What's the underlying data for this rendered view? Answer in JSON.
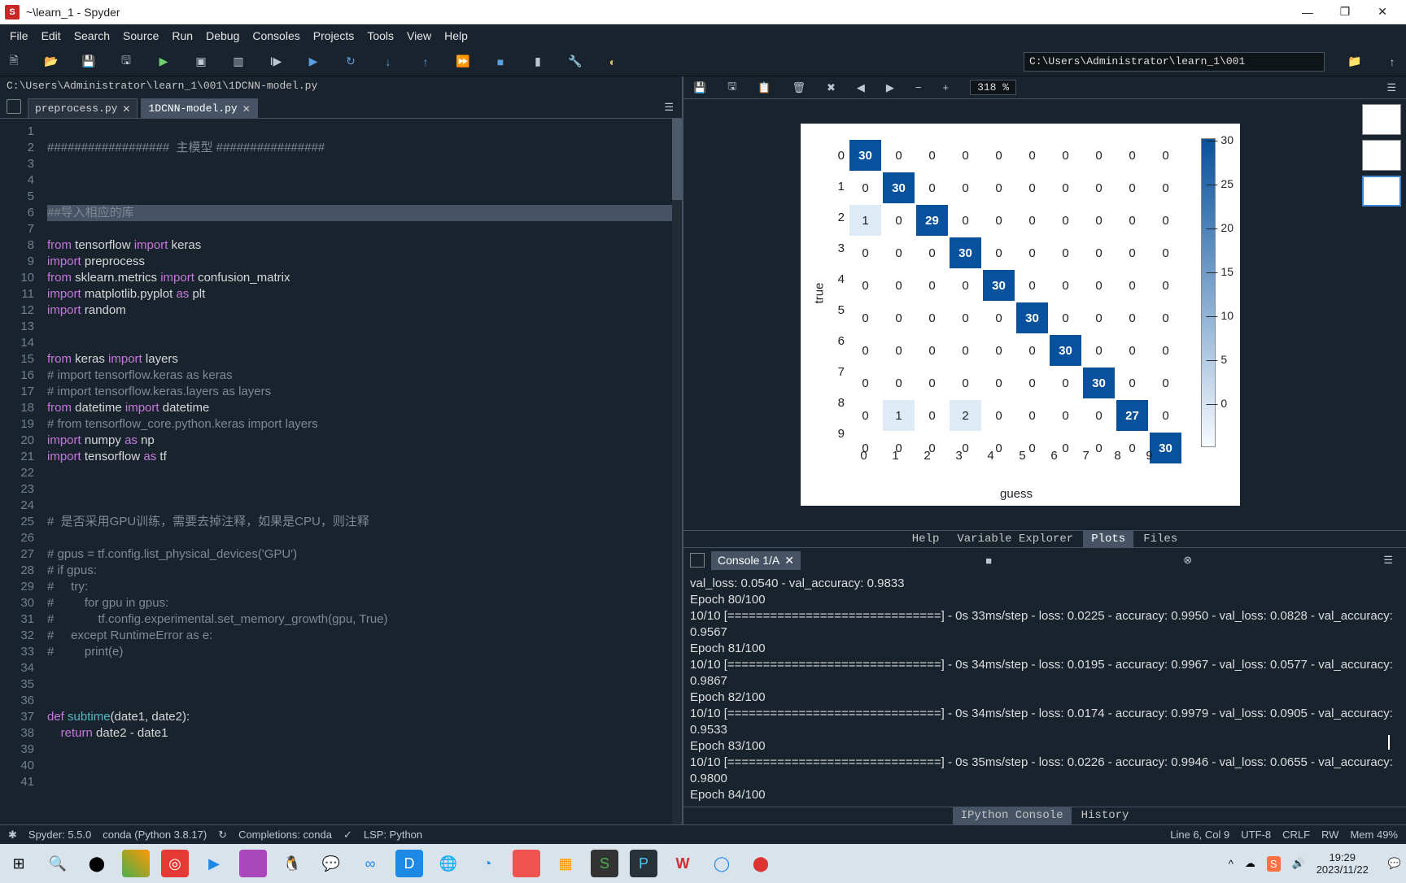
{
  "title": "~\\learn_1 - Spyder",
  "win_buttons": {
    "min": "—",
    "max": "❐",
    "close": "✕"
  },
  "menu": [
    "File",
    "Edit",
    "Search",
    "Source",
    "Run",
    "Debug",
    "Consoles",
    "Projects",
    "Tools",
    "View",
    "Help"
  ],
  "toolbar_path": "C:\\Users\\Administrator\\learn_1\\001",
  "editor_path": "C:\\Users\\Administrator\\learn_1\\001\\1DCNN-model.py",
  "tabs": [
    {
      "label": "preprocess.py",
      "active": false
    },
    {
      "label": "1DCNN-model.py",
      "active": true
    }
  ],
  "code_lines": [
    {
      "n": 1,
      "html": ""
    },
    {
      "n": 2,
      "html": "<span class='cmt'>##################  主模型 ################</span>"
    },
    {
      "n": 3,
      "html": ""
    },
    {
      "n": 4,
      "html": ""
    },
    {
      "n": 5,
      "html": ""
    },
    {
      "n": 6,
      "html": "<span class='cmt'>##导入相应的库</span>",
      "hl": true
    },
    {
      "n": 7,
      "html": ""
    },
    {
      "n": 8,
      "html": "<span class='kw'>from</span> <span class='mod'>tensorflow</span> <span class='kw'>import</span> <span class='mod'>keras</span>"
    },
    {
      "n": 9,
      "html": "<span class='kw'>import</span> <span class='mod'>preprocess</span>"
    },
    {
      "n": 10,
      "html": "<span class='kw'>from</span> <span class='mod'>sklearn.metrics</span> <span class='kw'>import</span> <span class='mod'>confusion_matrix</span>"
    },
    {
      "n": 11,
      "html": "<span class='kw'>import</span> <span class='mod'>matplotlib.pyplot</span> <span class='kw'>as</span> <span class='mod'>plt</span>"
    },
    {
      "n": 12,
      "html": "<span class='kw'>import</span> <span class='mod'>random</span>"
    },
    {
      "n": 13,
      "html": ""
    },
    {
      "n": 14,
      "html": ""
    },
    {
      "n": 15,
      "html": "<span class='kw'>from</span> <span class='mod'>keras</span> <span class='kw'>import</span> <span class='mod'>layers</span>"
    },
    {
      "n": 16,
      "html": "<span class='cmt'># import tensorflow.keras as keras</span>"
    },
    {
      "n": 17,
      "html": "<span class='cmt'># import tensorflow.keras.layers as layers</span>"
    },
    {
      "n": 18,
      "html": "<span class='kw'>from</span> <span class='mod'>datetime</span> <span class='kw'>import</span> <span class='mod'>datetime</span>"
    },
    {
      "n": 19,
      "html": "<span class='cmt'># from tensorflow_core.python.keras import layers</span>"
    },
    {
      "n": 20,
      "html": "<span class='kw'>import</span> <span class='mod'>numpy</span> <span class='kw'>as</span> <span class='mod'>np</span>"
    },
    {
      "n": 21,
      "html": "<span class='kw'>import</span> <span class='mod'>tensorflow</span> <span class='kw'>as</span> <span class='mod'>tf</span>"
    },
    {
      "n": 22,
      "html": ""
    },
    {
      "n": 23,
      "html": ""
    },
    {
      "n": 24,
      "html": ""
    },
    {
      "n": 25,
      "html": "<span class='cmt'>#  是否采用GPU训练，需要去掉注释，如果是CPU，则注释</span>"
    },
    {
      "n": 26,
      "html": ""
    },
    {
      "n": 27,
      "html": "<span class='cmt'># gpus = tf.config.list_physical_devices('GPU')</span>"
    },
    {
      "n": 28,
      "html": "<span class='cmt'># if gpus:</span>"
    },
    {
      "n": 29,
      "html": "<span class='cmt'>#     try:</span>"
    },
    {
      "n": 30,
      "html": "<span class='cmt'>#         for gpu in gpus:</span>"
    },
    {
      "n": 31,
      "html": "<span class='cmt'>#             tf.config.experimental.set_memory_growth(gpu, True)</span>"
    },
    {
      "n": 32,
      "html": "<span class='cmt'>#     except RuntimeError as e:</span>"
    },
    {
      "n": 33,
      "html": "<span class='cmt'>#         print(e)</span>"
    },
    {
      "n": 34,
      "html": ""
    },
    {
      "n": 35,
      "html": ""
    },
    {
      "n": 36,
      "html": ""
    },
    {
      "n": 37,
      "html": "<span class='kw'>def</span> <span class='fn'>subtime</span>(date1, date2):"
    },
    {
      "n": 38,
      "html": "    <span class='kw'>return</span> date2 - date1"
    },
    {
      "n": 39,
      "html": ""
    },
    {
      "n": 40,
      "html": ""
    },
    {
      "n": 41,
      "html": ""
    }
  ],
  "chart_data": {
    "type": "heatmap",
    "xlabel": "guess",
    "ylabel": "true",
    "categories": [
      "0",
      "1",
      "2",
      "3",
      "4",
      "5",
      "6",
      "7",
      "8",
      "9"
    ],
    "matrix": [
      [
        30,
        0,
        0,
        0,
        0,
        0,
        0,
        0,
        0,
        0
      ],
      [
        0,
        30,
        0,
        0,
        0,
        0,
        0,
        0,
        0,
        0
      ],
      [
        1,
        0,
        29,
        0,
        0,
        0,
        0,
        0,
        0,
        0
      ],
      [
        0,
        0,
        0,
        30,
        0,
        0,
        0,
        0,
        0,
        0
      ],
      [
        0,
        0,
        0,
        0,
        30,
        0,
        0,
        0,
        0,
        0
      ],
      [
        0,
        0,
        0,
        0,
        0,
        30,
        0,
        0,
        0,
        0
      ],
      [
        0,
        0,
        0,
        0,
        0,
        0,
        30,
        0,
        0,
        0
      ],
      [
        0,
        0,
        0,
        0,
        0,
        0,
        0,
        30,
        0,
        0
      ],
      [
        0,
        1,
        0,
        2,
        0,
        0,
        0,
        0,
        27,
        0
      ],
      [
        0,
        0,
        0,
        0,
        0,
        0,
        0,
        0,
        0,
        30
      ]
    ],
    "colorbar_ticks": [
      "30",
      "25",
      "20",
      "15",
      "10",
      "5",
      "0"
    ]
  },
  "plot_zoom": "318 %",
  "pane_tabs": [
    "Help",
    "Variable Explorer",
    "Plots",
    "Files"
  ],
  "pane_tabs_active": "Plots",
  "console_tab": "Console 1/A",
  "console_text": "val_loss: 0.0540 - val_accuracy: 0.9833\nEpoch 80/100\n10/10 [==============================] - 0s 33ms/step - loss: 0.0225 - accuracy: 0.9950 - val_loss: 0.0828 - val_accuracy: 0.9567\nEpoch 81/100\n10/10 [==============================] - 0s 34ms/step - loss: 0.0195 - accuracy: 0.9967 - val_loss: 0.0577 - val_accuracy: 0.9867\nEpoch 82/100\n10/10 [==============================] - 0s 34ms/step - loss: 0.0174 - accuracy: 0.9979 - val_loss: 0.0905 - val_accuracy: 0.9533\nEpoch 83/100\n10/10 [==============================] - 0s 35ms/step - loss: 0.0226 - accuracy: 0.9946 - val_loss: 0.0655 - val_accuracy: 0.9800\nEpoch 84/100",
  "console_bottom_tabs": [
    "IPython Console",
    "History"
  ],
  "console_bottom_active": "IPython Console",
  "status": {
    "spyder": "Spyder: 5.5.0",
    "conda": "conda (Python 3.8.17)",
    "comp": "Completions: conda",
    "lsp": "LSP: Python",
    "pos": "Line 6, Col 9",
    "enc": "UTF-8",
    "eol": "CRLF",
    "rw": "RW",
    "mem": "Mem 49%"
  },
  "clock": {
    "time": "19:29",
    "date": "2023/11/22"
  }
}
